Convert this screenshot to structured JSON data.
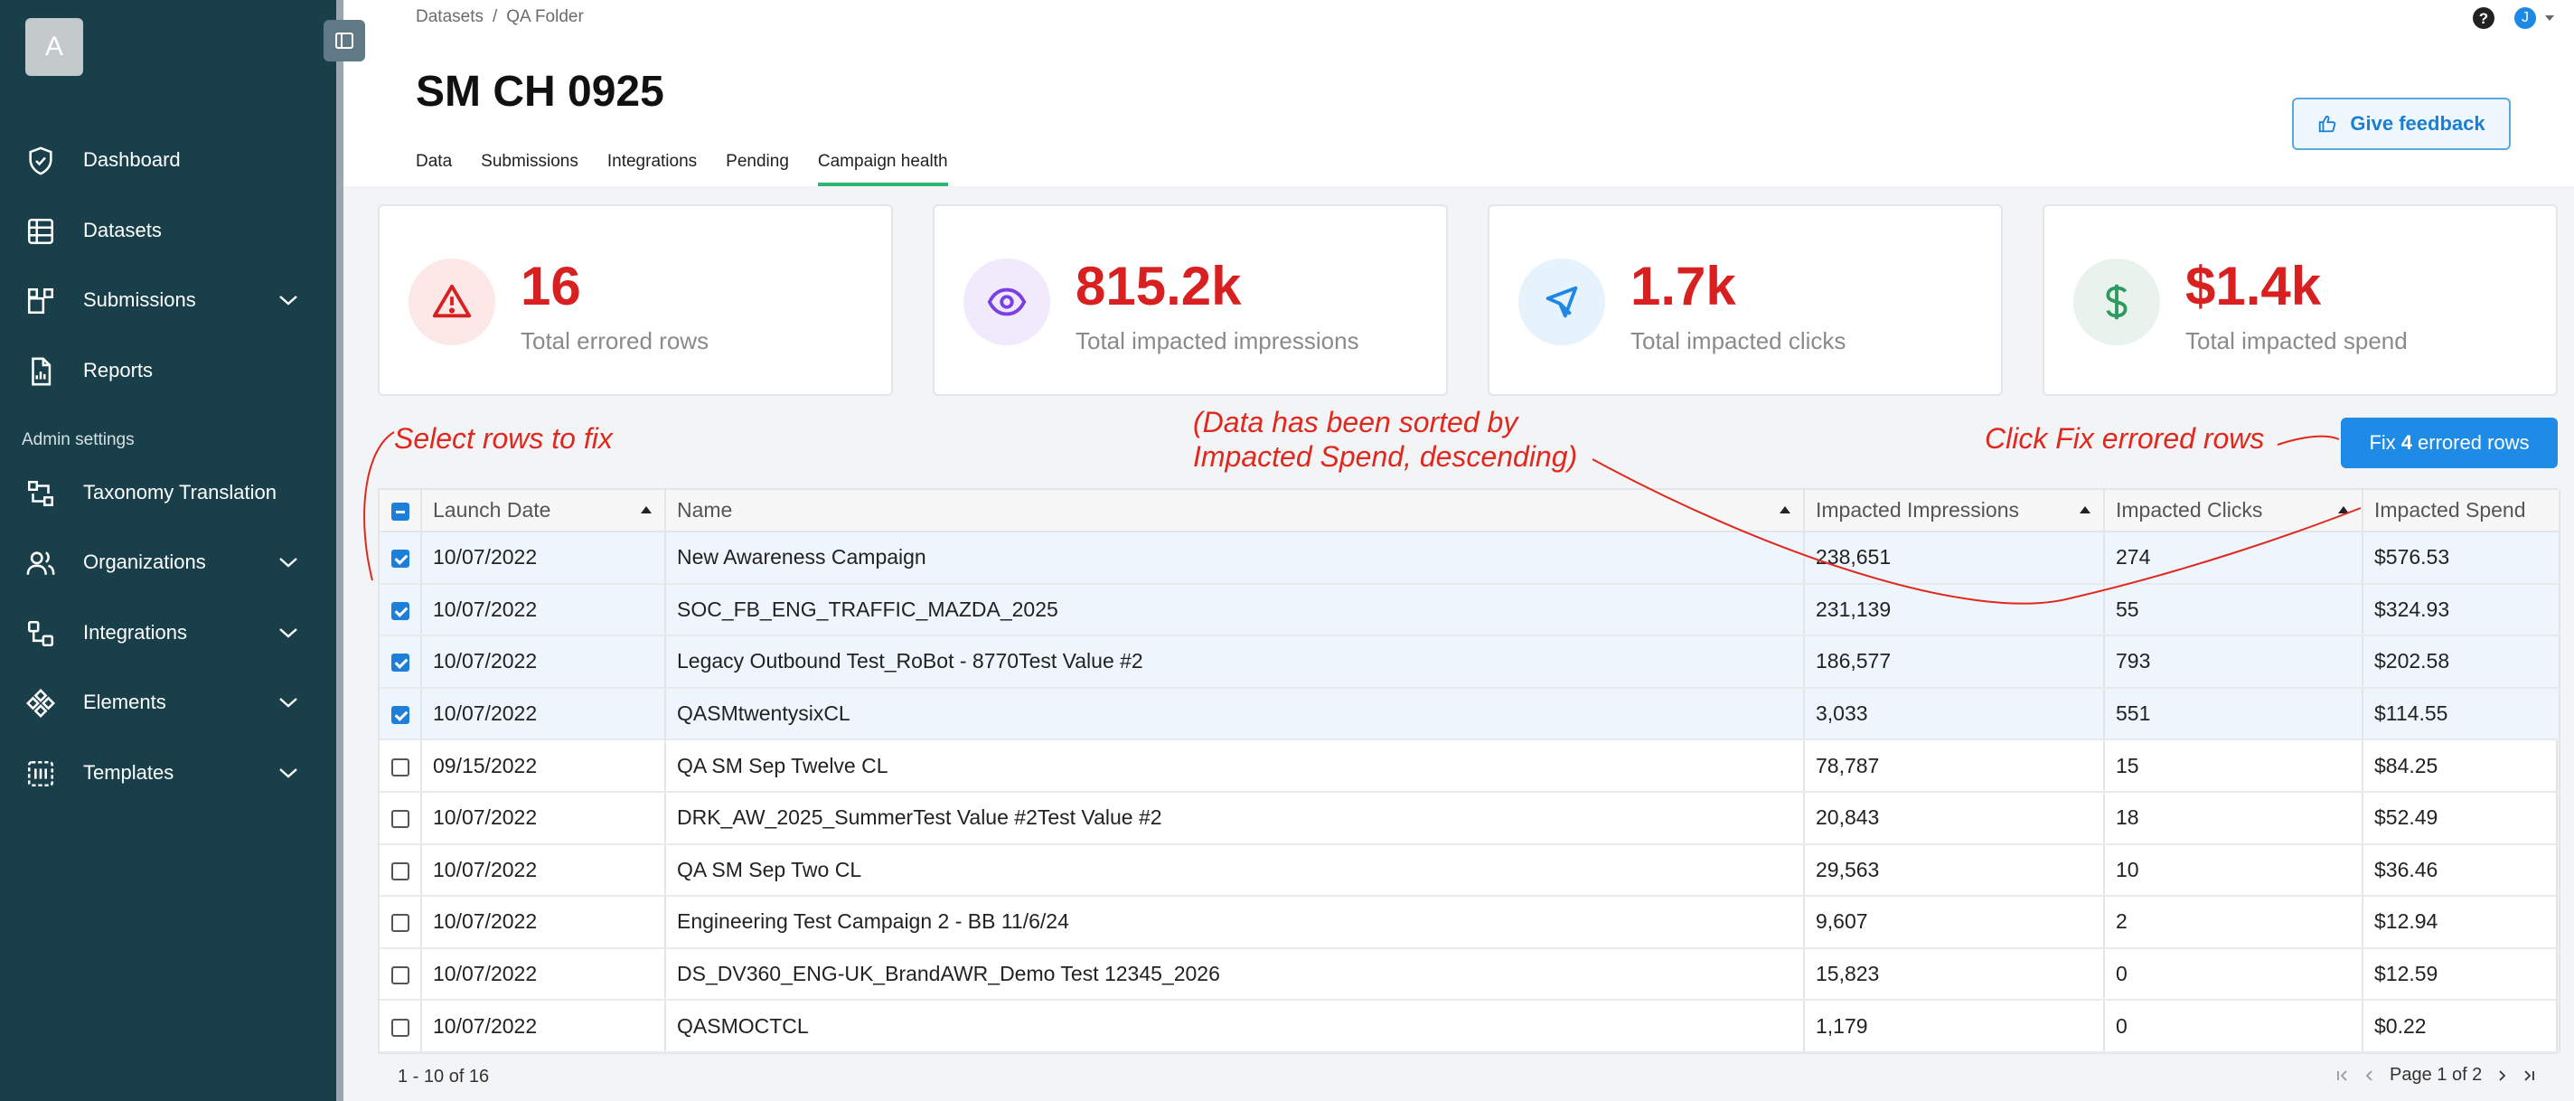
{
  "sidebar": {
    "logo_letter": "A",
    "items": [
      {
        "label": "Dashboard",
        "icon": "shield-icon"
      },
      {
        "label": "Datasets",
        "icon": "grid-icon"
      },
      {
        "label": "Submissions",
        "icon": "blocks-icon"
      },
      {
        "label": "Reports",
        "icon": "report-icon"
      }
    ],
    "admin_label": "Admin settings",
    "admin_items": [
      {
        "label": "Taxonomy Translation",
        "icon": "translate-icon"
      },
      {
        "label": "Organizations",
        "icon": "users-icon"
      },
      {
        "label": "Integrations",
        "icon": "integrations-icon"
      },
      {
        "label": "Elements",
        "icon": "elements-icon"
      },
      {
        "label": "Templates",
        "icon": "templates-icon"
      }
    ]
  },
  "header": {
    "breadcrumb": [
      "Datasets",
      "/",
      "QA Folder"
    ],
    "title": "SM CH 0925",
    "tabs": [
      "Data",
      "Submissions",
      "Integrations",
      "Pending",
      "Campaign health"
    ],
    "active_tab": "Campaign health",
    "feedback_label": "Give feedback",
    "avatar_initial": "J"
  },
  "stats": [
    {
      "value": "16",
      "label": "Total errored rows",
      "icon": "warning-icon",
      "color": "#d82020",
      "bg": "#fde8e8"
    },
    {
      "value": "815.2k",
      "label": "Total impacted impressions",
      "icon": "eye-icon",
      "color": "#7b3fe4",
      "bg": "#f0eafc"
    },
    {
      "value": "1.7k",
      "label": "Total impacted clicks",
      "icon": "cursor-icon",
      "color": "#1e88e5",
      "bg": "#e6f2fc"
    },
    {
      "value": "$1.4k",
      "label": "Total impacted spend",
      "icon": "dollar-icon",
      "color": "#2e9a5e",
      "bg": "#e8f3ed"
    }
  ],
  "annotations": {
    "select_rows": "Select rows to fix",
    "sorted_line1": "(Data has been sorted by",
    "sorted_line2": "Impacted Spend, descending)",
    "click_fix": "Click Fix errored rows"
  },
  "fix_button": {
    "prefix": "Fix",
    "count": "4",
    "suffix": "errored rows"
  },
  "table": {
    "columns": [
      "Launch Date",
      "Name",
      "Impacted Impressions",
      "Impacted Clicks",
      "Impacted Spend"
    ],
    "rows": [
      {
        "selected": true,
        "date": "10/07/2022",
        "name": "New Awareness Campaign",
        "impressions": "238,651",
        "clicks": "274",
        "spend": "$576.53"
      },
      {
        "selected": true,
        "date": "10/07/2022",
        "name": "SOC_FB_ENG_TRAFFIC_MAZDA_2025",
        "impressions": "231,139",
        "clicks": "55",
        "spend": "$324.93"
      },
      {
        "selected": true,
        "date": "10/07/2022",
        "name": "Legacy Outbound Test_RoBot - 8770Test Value #2",
        "impressions": "186,577",
        "clicks": "793",
        "spend": "$202.58"
      },
      {
        "selected": true,
        "date": "10/07/2022",
        "name": "QASMtwentysixCL",
        "impressions": "3,033",
        "clicks": "551",
        "spend": "$114.55"
      },
      {
        "selected": false,
        "date": "09/15/2022",
        "name": "QA SM Sep Twelve CL",
        "impressions": "78,787",
        "clicks": "15",
        "spend": "$84.25"
      },
      {
        "selected": false,
        "date": "10/07/2022",
        "name": "DRK_AW_2025_SummerTest Value #2Test Value #2",
        "impressions": "20,843",
        "clicks": "18",
        "spend": "$52.49"
      },
      {
        "selected": false,
        "date": "10/07/2022",
        "name": "QA SM Sep Two CL",
        "impressions": "29,563",
        "clicks": "10",
        "spend": "$36.46"
      },
      {
        "selected": false,
        "date": "10/07/2022",
        "name": "Engineering Test Campaign 2 - BB 11/6/24",
        "impressions": "9,607",
        "clicks": "2",
        "spend": "$12.94"
      },
      {
        "selected": false,
        "date": "10/07/2022",
        "name": "DS_DV360_ENG-UK_BrandAWR_Demo Test 12345_2026",
        "impressions": "15,823",
        "clicks": "0",
        "spend": "$12.59"
      },
      {
        "selected": false,
        "date": "10/07/2022",
        "name": "QASMOCTCL",
        "impressions": "1,179",
        "clicks": "0",
        "spend": "$0.22"
      }
    ]
  },
  "pagination": {
    "range": "1 - 10 of 16",
    "page": "Page 1 of 2"
  }
}
